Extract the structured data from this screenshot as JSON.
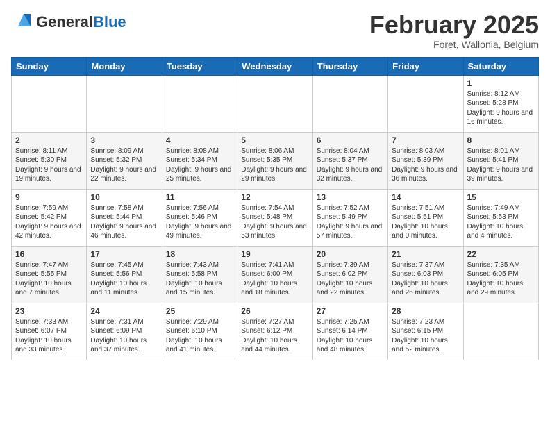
{
  "header": {
    "logo_general": "General",
    "logo_blue": "Blue",
    "month_title": "February 2025",
    "subtitle": "Foret, Wallonia, Belgium"
  },
  "weekdays": [
    "Sunday",
    "Monday",
    "Tuesday",
    "Wednesday",
    "Thursday",
    "Friday",
    "Saturday"
  ],
  "weeks": [
    [
      {
        "day": "",
        "info": ""
      },
      {
        "day": "",
        "info": ""
      },
      {
        "day": "",
        "info": ""
      },
      {
        "day": "",
        "info": ""
      },
      {
        "day": "",
        "info": ""
      },
      {
        "day": "",
        "info": ""
      },
      {
        "day": "1",
        "info": "Sunrise: 8:12 AM\nSunset: 5:28 PM\nDaylight: 9 hours and 16 minutes."
      }
    ],
    [
      {
        "day": "2",
        "info": "Sunrise: 8:11 AM\nSunset: 5:30 PM\nDaylight: 9 hours and 19 minutes."
      },
      {
        "day": "3",
        "info": "Sunrise: 8:09 AM\nSunset: 5:32 PM\nDaylight: 9 hours and 22 minutes."
      },
      {
        "day": "4",
        "info": "Sunrise: 8:08 AM\nSunset: 5:34 PM\nDaylight: 9 hours and 25 minutes."
      },
      {
        "day": "5",
        "info": "Sunrise: 8:06 AM\nSunset: 5:35 PM\nDaylight: 9 hours and 29 minutes."
      },
      {
        "day": "6",
        "info": "Sunrise: 8:04 AM\nSunset: 5:37 PM\nDaylight: 9 hours and 32 minutes."
      },
      {
        "day": "7",
        "info": "Sunrise: 8:03 AM\nSunset: 5:39 PM\nDaylight: 9 hours and 36 minutes."
      },
      {
        "day": "8",
        "info": "Sunrise: 8:01 AM\nSunset: 5:41 PM\nDaylight: 9 hours and 39 minutes."
      }
    ],
    [
      {
        "day": "9",
        "info": "Sunrise: 7:59 AM\nSunset: 5:42 PM\nDaylight: 9 hours and 42 minutes."
      },
      {
        "day": "10",
        "info": "Sunrise: 7:58 AM\nSunset: 5:44 PM\nDaylight: 9 hours and 46 minutes."
      },
      {
        "day": "11",
        "info": "Sunrise: 7:56 AM\nSunset: 5:46 PM\nDaylight: 9 hours and 49 minutes."
      },
      {
        "day": "12",
        "info": "Sunrise: 7:54 AM\nSunset: 5:48 PM\nDaylight: 9 hours and 53 minutes."
      },
      {
        "day": "13",
        "info": "Sunrise: 7:52 AM\nSunset: 5:49 PM\nDaylight: 9 hours and 57 minutes."
      },
      {
        "day": "14",
        "info": "Sunrise: 7:51 AM\nSunset: 5:51 PM\nDaylight: 10 hours and 0 minutes."
      },
      {
        "day": "15",
        "info": "Sunrise: 7:49 AM\nSunset: 5:53 PM\nDaylight: 10 hours and 4 minutes."
      }
    ],
    [
      {
        "day": "16",
        "info": "Sunrise: 7:47 AM\nSunset: 5:55 PM\nDaylight: 10 hours and 7 minutes."
      },
      {
        "day": "17",
        "info": "Sunrise: 7:45 AM\nSunset: 5:56 PM\nDaylight: 10 hours and 11 minutes."
      },
      {
        "day": "18",
        "info": "Sunrise: 7:43 AM\nSunset: 5:58 PM\nDaylight: 10 hours and 15 minutes."
      },
      {
        "day": "19",
        "info": "Sunrise: 7:41 AM\nSunset: 6:00 PM\nDaylight: 10 hours and 18 minutes."
      },
      {
        "day": "20",
        "info": "Sunrise: 7:39 AM\nSunset: 6:02 PM\nDaylight: 10 hours and 22 minutes."
      },
      {
        "day": "21",
        "info": "Sunrise: 7:37 AM\nSunset: 6:03 PM\nDaylight: 10 hours and 26 minutes."
      },
      {
        "day": "22",
        "info": "Sunrise: 7:35 AM\nSunset: 6:05 PM\nDaylight: 10 hours and 29 minutes."
      }
    ],
    [
      {
        "day": "23",
        "info": "Sunrise: 7:33 AM\nSunset: 6:07 PM\nDaylight: 10 hours and 33 minutes."
      },
      {
        "day": "24",
        "info": "Sunrise: 7:31 AM\nSunset: 6:09 PM\nDaylight: 10 hours and 37 minutes."
      },
      {
        "day": "25",
        "info": "Sunrise: 7:29 AM\nSunset: 6:10 PM\nDaylight: 10 hours and 41 minutes."
      },
      {
        "day": "26",
        "info": "Sunrise: 7:27 AM\nSunset: 6:12 PM\nDaylight: 10 hours and 44 minutes."
      },
      {
        "day": "27",
        "info": "Sunrise: 7:25 AM\nSunset: 6:14 PM\nDaylight: 10 hours and 48 minutes."
      },
      {
        "day": "28",
        "info": "Sunrise: 7:23 AM\nSunset: 6:15 PM\nDaylight: 10 hours and 52 minutes."
      },
      {
        "day": "",
        "info": ""
      }
    ]
  ]
}
